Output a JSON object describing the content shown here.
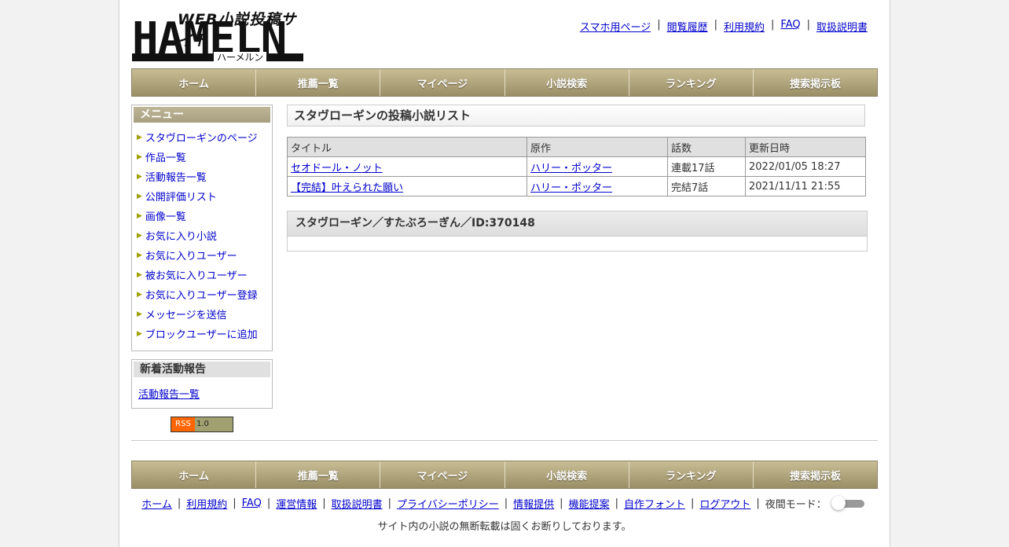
{
  "logo": {
    "top_text": "WEB小説投稿サイト",
    "main_text": "HAMELN",
    "kana": "ハーメルン"
  },
  "top_links": [
    "スマホ用ページ",
    "閲覧履歴",
    "利用規約",
    "FAQ",
    "取扱説明書"
  ],
  "nav": [
    "ホーム",
    "推薦一覧",
    "マイページ",
    "小説検索",
    "ランキング",
    "捜索掲示板"
  ],
  "sidebar": {
    "menu_title": "メニュー",
    "menu_items": [
      "スタヴローギンのページ",
      "作品一覧",
      "活動報告一覧",
      "公開評価リスト",
      "画像一覧",
      "お気に入り小説",
      "お気に入りユーザー",
      "被お気に入りユーザー",
      "お気に入りユーザー登録",
      "メッセージを送信",
      "ブロックユーザーに追加"
    ],
    "news_title": "新着活動報告",
    "news_link": "活動報告一覧",
    "rss_left": "RSS",
    "rss_right": "1.0"
  },
  "main": {
    "title": "スタヴローギンの投稿小説リスト",
    "table": {
      "headers": [
        "タイトル",
        "原作",
        "話数",
        "更新日時"
      ],
      "rows": [
        [
          "セオドール・ノット",
          "ハリー・ポッター",
          "連載17話",
          "2022/01/05 18:27"
        ],
        [
          "【完結】叶えられた願い",
          "ハリー・ポッター",
          "完結7話",
          "2021/11/11 21:55"
        ]
      ]
    },
    "user_heading": "スタヴローギン／すたぶろーぎん／ID:370148"
  },
  "footer": {
    "links": [
      "ホーム",
      "利用規約",
      "FAQ",
      "運営情報",
      "取扱説明書",
      "プライバシーポリシー",
      "情報提供",
      "機能提案",
      "自作フォント",
      "ログアウト"
    ],
    "night_mode_label": "夜間モード：",
    "notice": "サイト内の小説の無断転載は固くお断りしております。"
  }
}
